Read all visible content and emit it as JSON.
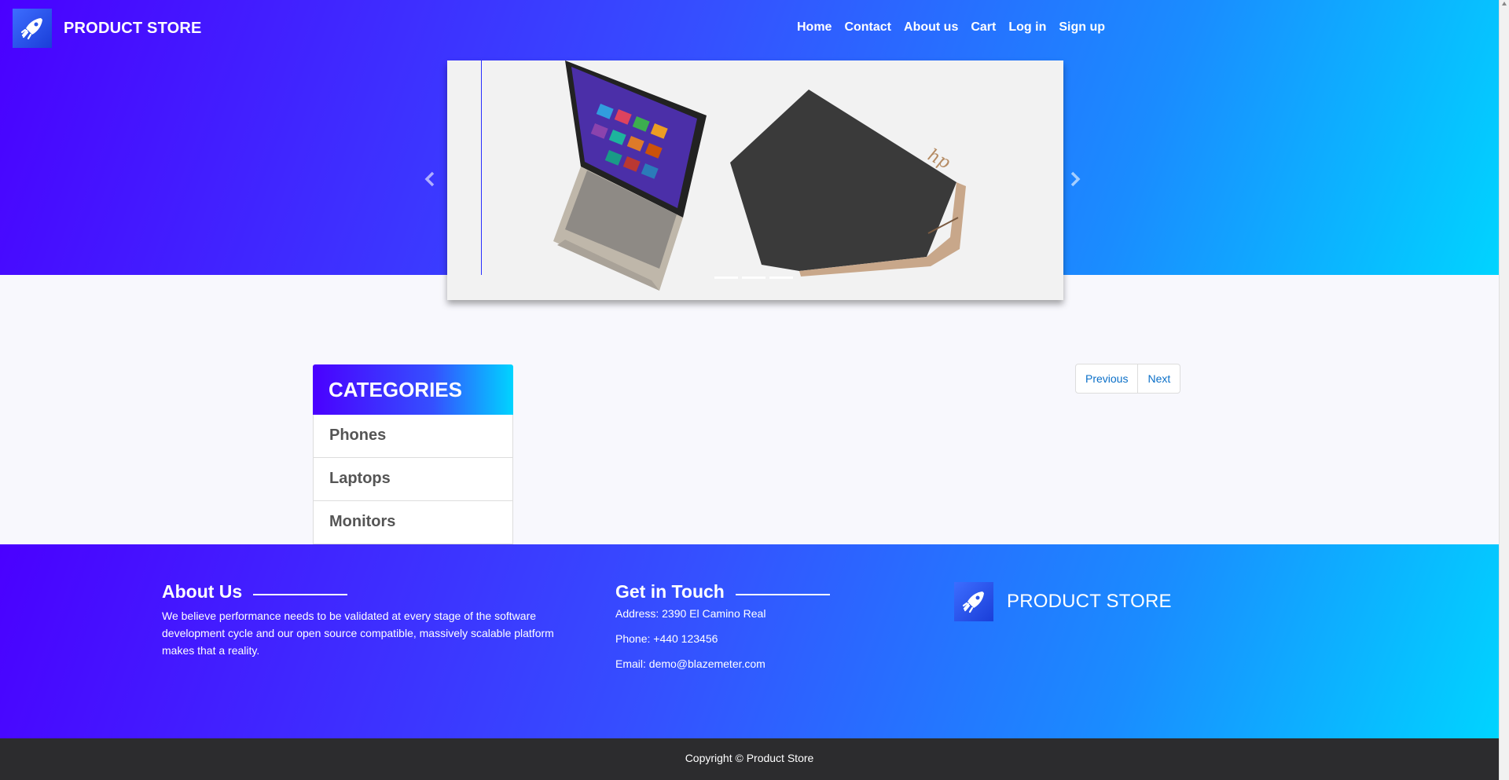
{
  "nav": {
    "brand": "PRODUCT STORE",
    "links": [
      "Home",
      "Contact",
      "About us",
      "Cart",
      "Log in",
      "Sign up"
    ]
  },
  "carousel": {
    "slide_image": "laptop-pair-image",
    "indicator_count": 3
  },
  "categories": {
    "title": "CATEGORIES",
    "items": [
      "Phones",
      "Laptops",
      "Monitors"
    ]
  },
  "pagination": {
    "previous": "Previous",
    "next": "Next"
  },
  "footer": {
    "about": {
      "title": "About Us",
      "text": "We believe performance needs to be validated at every stage of the software development cycle and our open source compatible, massively scalable platform makes that a reality."
    },
    "contact": {
      "title": "Get in Touch",
      "address": "Address: 2390 El Camino Real",
      "phone": "Phone: +440 123456",
      "email": "Email: demo@blazemeter.com"
    },
    "brand": "PRODUCT STORE"
  },
  "copyright": "Copyright © Product Store",
  "colors": {
    "gradient_start": "#4a00ff",
    "gradient_end": "#00d4ff",
    "link_blue": "#0a6fc8",
    "copyright_bg": "#2c2c2e"
  }
}
